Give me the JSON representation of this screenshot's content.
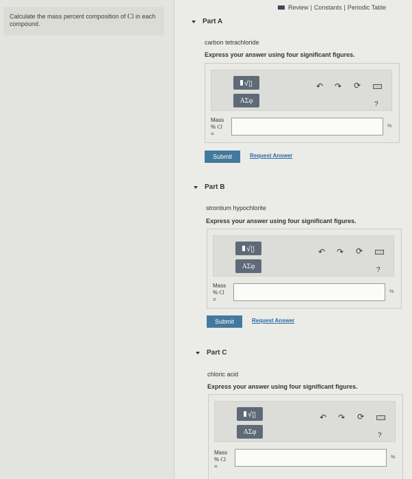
{
  "prompt": {
    "text_before": "Calculate the mass percent composition of ",
    "element": "Cl",
    "text_after": " in each compound."
  },
  "toplinks": {
    "review": "Review",
    "sep1": "|",
    "constants": "Constants",
    "sep2": "|",
    "periodic": "Periodic Table"
  },
  "toolbar_common": {
    "greek": "AΣφ",
    "help": "?",
    "undo": "↶",
    "redo": "↷",
    "reset": "⟳"
  },
  "mass_label": {
    "line1": "Mass",
    "line2a": "% ",
    "line2b": "Cl",
    "line3": "="
  },
  "unit": "%",
  "buttons": {
    "submit": "Submit",
    "request": "Request Answer"
  },
  "parts": [
    {
      "title": "Part A",
      "compound": "carbon tetrachloride",
      "instruction": "Express your answer using four significant figures.",
      "answer": ""
    },
    {
      "title": "Part B",
      "compound": "strontium hypochlorite",
      "instruction": "Express your answer using four significant figures.",
      "answer": ""
    },
    {
      "title": "Part C",
      "compound": "chloric acid",
      "instruction": "Express your answer using four significant figures.",
      "answer": ""
    }
  ]
}
